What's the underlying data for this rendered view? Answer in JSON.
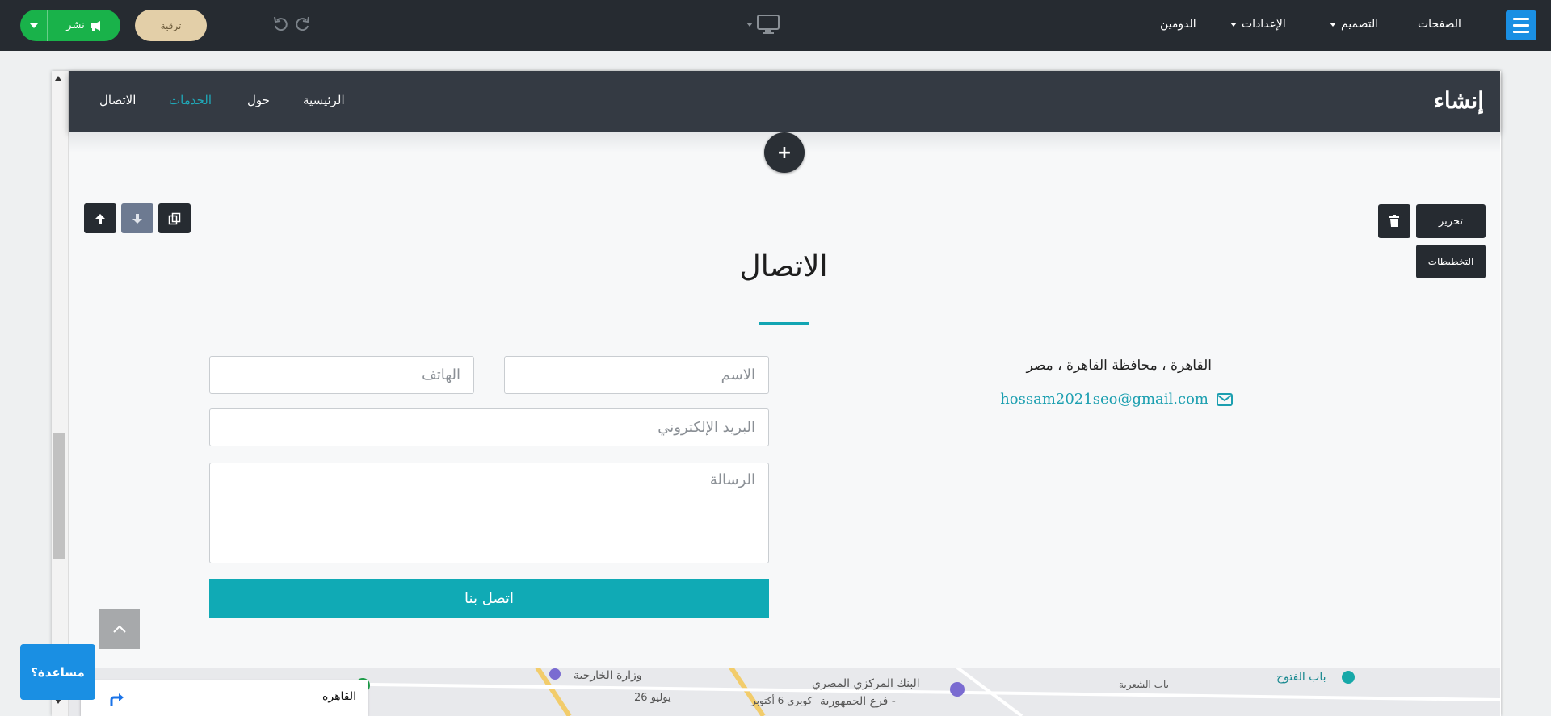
{
  "toolbar": {
    "publish_label": "نشر",
    "upgrade_label": "ترقية",
    "nav": {
      "pages": "الصفحات",
      "design": "التصميم",
      "settings": "الإعدادات",
      "domain": "الدومين"
    }
  },
  "site": {
    "logo": "إنشاء",
    "nav": {
      "home": "الرئيسية",
      "about": "حول",
      "services": "الخدمات",
      "contact": "الاتصال"
    }
  },
  "section_tools": {
    "edit_label": "تحرير",
    "layouts_label": "التخطيطات"
  },
  "contact": {
    "title": "الاتصال",
    "address": "القاهرة ، محافظة القاهرة ، مصر",
    "email": "hossam2021seo@gmail.com",
    "form": {
      "name_placeholder": "الاسم",
      "phone_placeholder": "الهاتف",
      "email_placeholder": "البريد الإلكتروني",
      "message_placeholder": "الرسالة",
      "submit_label": "اتصل بنا"
    }
  },
  "map": {
    "city": "القاهره",
    "labels": {
      "foreign_ministry": "وزارة الخارجية",
      "central_bank": "البنك المركزي المصري",
      "republic_branch": "فرع الجمهورية -",
      "bab_elfutuh": "باب الفتوح",
      "bab_elshaaria": "باب الشعرية",
      "july_26": "26 يوليو",
      "october_6_bridge": "كوبري 6 أكتوبر"
    }
  },
  "help": {
    "label": "مساعدة؟"
  },
  "colors": {
    "topbar": "#262b31",
    "publish": "#19b24a",
    "upgrade": "#e3cfa8",
    "accent_teal": "#10aab5",
    "brand_blue": "#1a8fe3",
    "site_header": "#343a43"
  }
}
